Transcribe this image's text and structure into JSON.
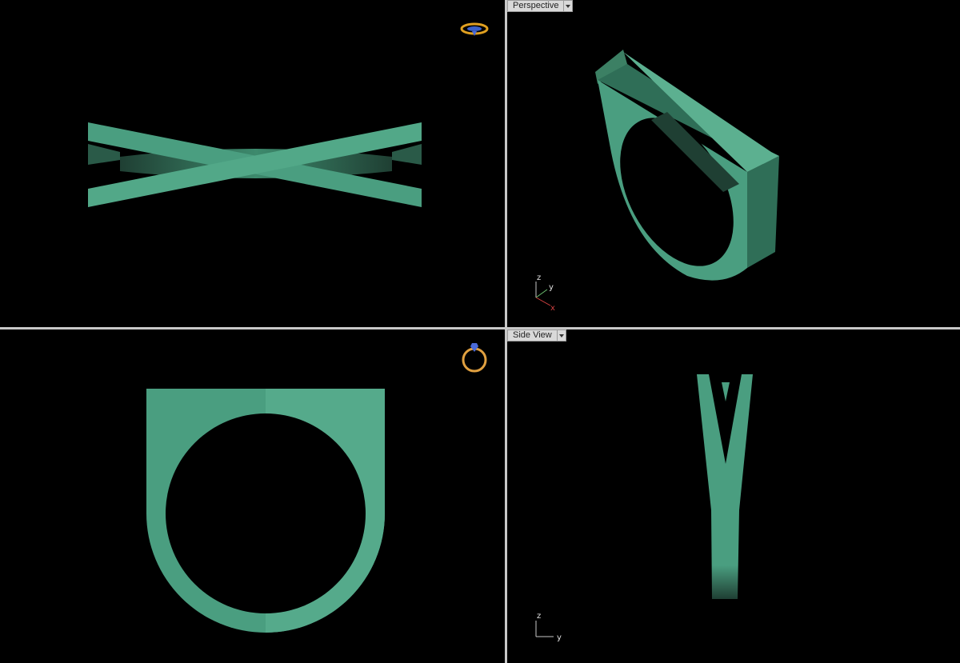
{
  "viewports": {
    "perspective": {
      "label": "Perspective"
    },
    "side": {
      "label": "Side View"
    }
  },
  "axes": {
    "x": "x",
    "y": "y",
    "z": "z"
  },
  "colors": {
    "model": "#4a9e80",
    "model_dark": "#2f6e57",
    "background": "#000000",
    "divider": "#c8c8c8"
  }
}
